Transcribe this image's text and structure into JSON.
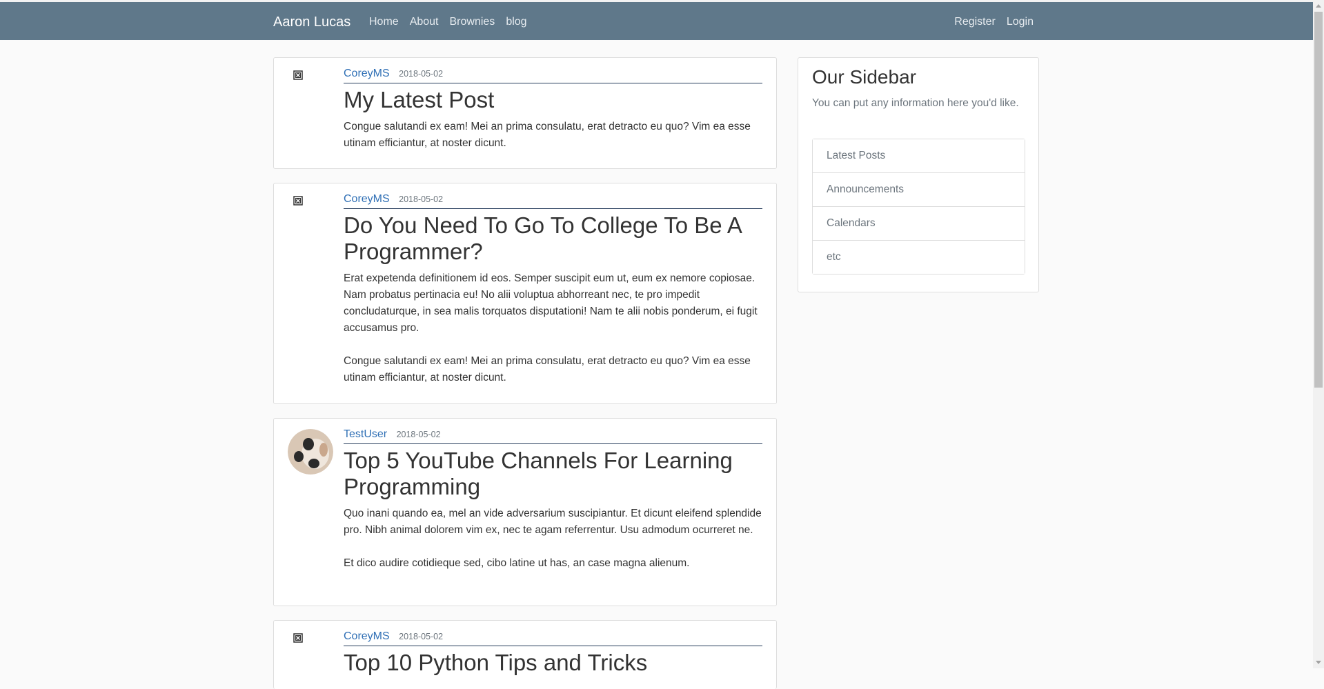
{
  "navbar": {
    "brand": "Aaron Lucas",
    "links": [
      "Home",
      "About",
      "Brownies",
      "blog"
    ],
    "right_links": [
      "Register",
      "Login"
    ]
  },
  "posts": [
    {
      "author": "CoreyMS",
      "date": "2018-05-02",
      "title": "My Latest Post",
      "content": "Congue salutandi ex eam! Mei an prima consulatu, erat detracto eu quo? Vim ea esse utinam efficiantur, at noster dicunt."
    },
    {
      "author": "CoreyMS",
      "date": "2018-05-02",
      "title": "Do You Need To Go To College To Be A Programmer?",
      "content": "Erat expetenda definitionem id eos. Semper suscipit eum ut, eum ex nemore copiosae. Nam probatus pertinacia eu! No alii voluptua abhorreant nec, te pro impedit concludaturque, in sea malis torquatos disputationi! Nam te alii nobis ponderum, ei fugit accusamus pro.\n\nCongue salutandi ex eam! Mei an prima consulatu, erat detracto eu quo? Vim ea esse utinam efficiantur, at noster dicunt."
    },
    {
      "author": "TestUser",
      "date": "2018-05-02",
      "title": "Top 5 YouTube Channels For Learning Programming",
      "content": "Quo inani quando ea, mel an vide adversarium suscipiantur. Et dicunt eleifend splendide pro. Nibh animal dolorem vim ex, nec te agam referrentur. Usu admodum ocurreret ne.\n\nEt dico audire cotidieque sed, cibo latine ut has, an case magna alienum."
    },
    {
      "author": "CoreyMS",
      "date": "2018-05-02",
      "title": "Top 10 Python Tips and Tricks"
    }
  ],
  "sidebar": {
    "title": "Our Sidebar",
    "text": "You can put any information here you'd like.",
    "items": [
      "Latest Posts",
      "Announcements",
      "Calendars",
      "etc"
    ]
  }
}
